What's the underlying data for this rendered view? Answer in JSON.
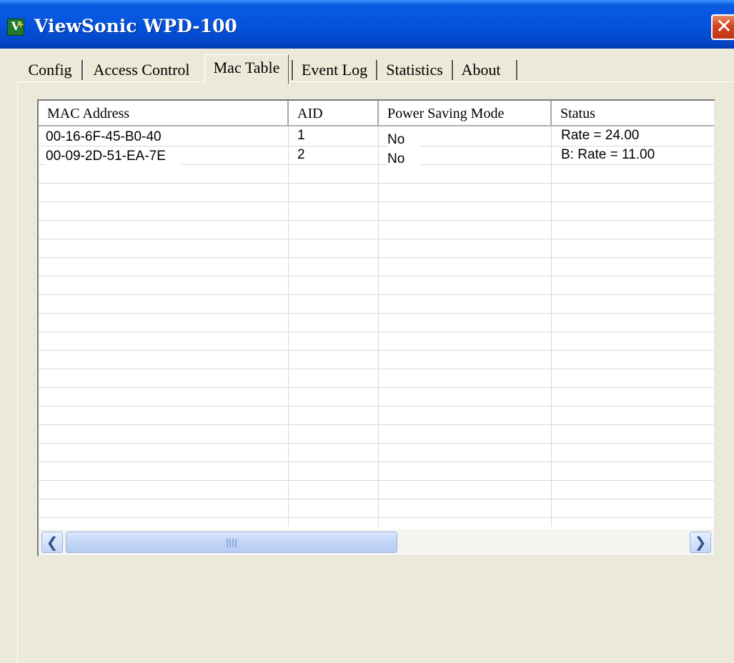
{
  "window": {
    "title": "ViewSonic WPD-100",
    "icon": "viewsonic-app-icon",
    "close_glyph": "✕"
  },
  "tabs": [
    {
      "label": "Config"
    },
    {
      "label": "Access Control"
    },
    {
      "label": "Mac Table",
      "selected": true
    },
    {
      "label": "Event Log"
    },
    {
      "label": "Statistics"
    },
    {
      "label": "About"
    }
  ],
  "table": {
    "columns": [
      "MAC Address",
      "AID",
      "Power Saving Mode",
      "Status"
    ],
    "rows": [
      [
        "00-16-6F-45-B0-40",
        "1",
        "No",
        "Rate = 24.00"
      ],
      [
        "00-09-2D-51-EA-7E",
        "2",
        "No",
        "B: Rate = 11.00"
      ]
    ]
  },
  "scrollbar": {
    "left_glyph": "❮",
    "right_glyph": "❯"
  },
  "colors": {
    "titlebar": "#0453de",
    "face": "#ece9d8",
    "close": "#d2451d"
  }
}
